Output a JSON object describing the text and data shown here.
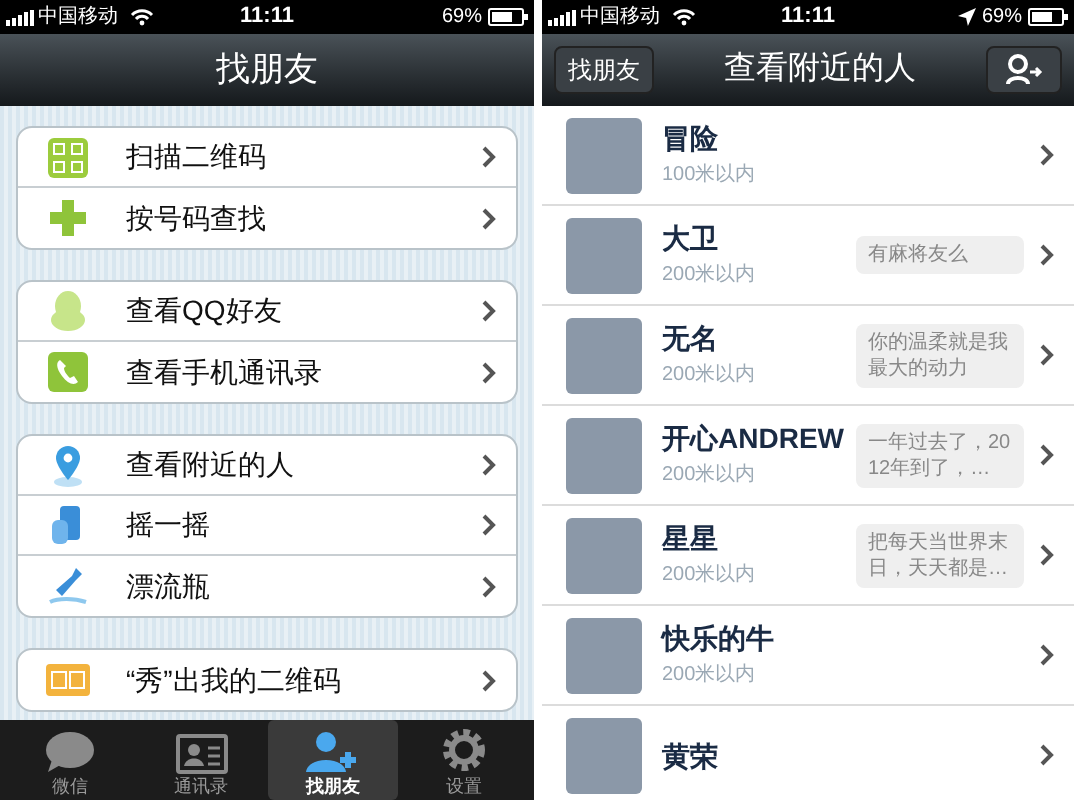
{
  "find_friends_screen": {
    "status_bar": {
      "carrier": "中国移动",
      "time": "11:11",
      "battery": "69%",
      "location_on": false
    },
    "nav_bar": {
      "title": "找朋友"
    },
    "groups": [
      [
        {
          "label": "扫描二维码"
        },
        {
          "label": "按号码查找"
        }
      ],
      [
        {
          "label": "查看QQ好友"
        },
        {
          "label": "查看手机通讯录"
        }
      ],
      [
        {
          "label": "查看附近的人"
        },
        {
          "label": "摇一摇"
        },
        {
          "label": "漂流瓶"
        }
      ],
      [
        {
          "label": "“秀”出我的二维码"
        }
      ]
    ],
    "tab_bar": [
      {
        "label": "微信",
        "selected": false
      },
      {
        "label": "通讯录",
        "selected": false
      },
      {
        "label": "找朋友",
        "selected": true
      },
      {
        "label": "设置",
        "selected": false
      }
    ]
  },
  "nearby_screen": {
    "status_bar": {
      "carrier": "中国移动",
      "time": "11:11",
      "battery": "69%",
      "location_on": true
    },
    "nav_bar": {
      "back": "找朋友",
      "title": "查看附近的人"
    },
    "people": [
      {
        "name": "冒险",
        "distance": "100米以内"
      },
      {
        "name": "大卫",
        "distance": "200米以内",
        "status": "有麻将友么"
      },
      {
        "name": "无名",
        "distance": "200米以内",
        "status": "你的温柔就是我最大的动力"
      },
      {
        "name": "开心ANDREW",
        "distance": "200米以内",
        "status": "一年过去了，2012年到了，…"
      },
      {
        "name": "星星",
        "distance": "200米以内",
        "status": "把每天当世界末日，天天都是…"
      },
      {
        "name": "快乐的牛",
        "distance": "200米以内"
      },
      {
        "name": "黄荣"
      }
    ]
  }
}
